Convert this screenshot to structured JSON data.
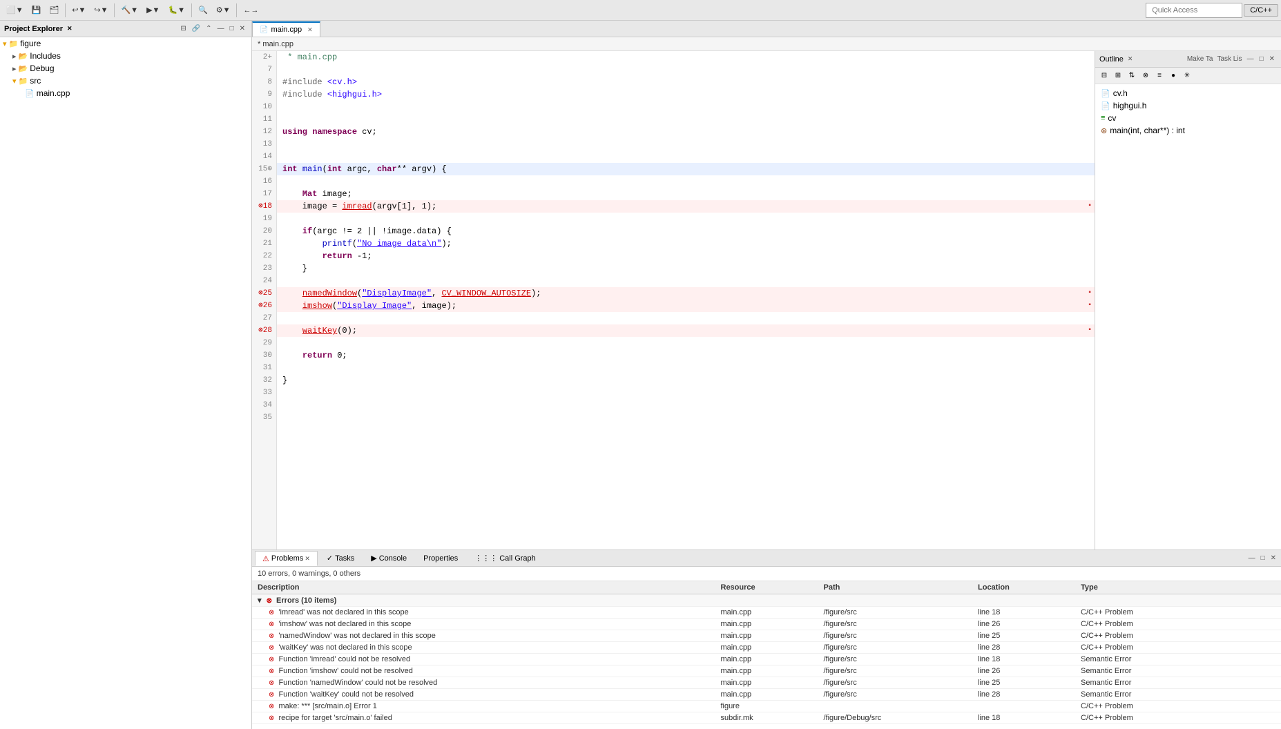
{
  "toolbar": {
    "quick_access_placeholder": "Quick Access",
    "lang_label": "C/C++"
  },
  "project_explorer": {
    "title": "Project Explorer",
    "items": [
      {
        "label": "figure",
        "type": "project",
        "depth": 0,
        "expanded": true
      },
      {
        "label": "Includes",
        "type": "folder",
        "depth": 1,
        "expanded": false
      },
      {
        "label": "Debug",
        "type": "folder",
        "depth": 1,
        "expanded": false
      },
      {
        "label": "src",
        "type": "folder",
        "depth": 1,
        "expanded": true
      },
      {
        "label": "main.cpp",
        "type": "file",
        "depth": 2
      }
    ]
  },
  "editor": {
    "tab_label": "main.cpp",
    "tab_dirty": false,
    "breadcrumb": "* main.cpp",
    "lines": [
      {
        "num": "2+",
        "content": "* main.cpp",
        "type": "comment"
      },
      {
        "num": "7",
        "content": "",
        "type": "normal"
      },
      {
        "num": "8",
        "content": "#include <cv.h>",
        "type": "preproc"
      },
      {
        "num": "9",
        "content": "#include <highgui.h>",
        "type": "preproc"
      },
      {
        "num": "10",
        "content": "",
        "type": "normal"
      },
      {
        "num": "11",
        "content": "",
        "type": "normal"
      },
      {
        "num": "12",
        "content": "using namespace cv;",
        "type": "normal"
      },
      {
        "num": "13",
        "content": "",
        "type": "normal"
      },
      {
        "num": "14",
        "content": "",
        "type": "normal"
      },
      {
        "num": "15♦",
        "content": "int main(int argc, char** argv) {",
        "type": "normal",
        "highlighted": true
      },
      {
        "num": "16",
        "content": "",
        "type": "normal"
      },
      {
        "num": "17",
        "content": "    Mat image;",
        "type": "normal"
      },
      {
        "num": "18",
        "content": "    image = imread(argv[1], 1);",
        "type": "error"
      },
      {
        "num": "19",
        "content": "",
        "type": "normal"
      },
      {
        "num": "20",
        "content": "    if(argc != 2 || !image.data) {",
        "type": "normal"
      },
      {
        "num": "21",
        "content": "        printf(\"No image data\\n\");",
        "type": "normal"
      },
      {
        "num": "22",
        "content": "        return -1;",
        "type": "normal"
      },
      {
        "num": "23",
        "content": "    }",
        "type": "normal"
      },
      {
        "num": "24",
        "content": "",
        "type": "normal"
      },
      {
        "num": "25",
        "content": "    namedWindow(\"DisplayImage\", CV_WINDOW_AUTOSIZE);",
        "type": "error"
      },
      {
        "num": "26",
        "content": "    imshow(\"Display Image\", image);",
        "type": "error"
      },
      {
        "num": "27",
        "content": "",
        "type": "normal"
      },
      {
        "num": "28",
        "content": "    waitKey(0);",
        "type": "error"
      },
      {
        "num": "29",
        "content": "",
        "type": "normal"
      },
      {
        "num": "30",
        "content": "    return 0;",
        "type": "normal"
      },
      {
        "num": "31",
        "content": "",
        "type": "normal"
      },
      {
        "num": "32",
        "content": "}",
        "type": "normal"
      },
      {
        "num": "33",
        "content": "",
        "type": "normal"
      },
      {
        "num": "34",
        "content": "",
        "type": "normal"
      },
      {
        "num": "35",
        "content": "",
        "type": "normal"
      }
    ]
  },
  "bottom_panel": {
    "tabs": [
      {
        "label": "Problems",
        "active": true,
        "icon": "⚠"
      },
      {
        "label": "Tasks",
        "active": false,
        "icon": "✓"
      },
      {
        "label": "Console",
        "active": false,
        "icon": "▶"
      },
      {
        "label": "Properties",
        "active": false,
        "icon": ""
      },
      {
        "label": "Call Graph",
        "active": false,
        "icon": "⋮⋮⋮"
      }
    ],
    "problems_summary": "10 errors, 0 warnings, 0 others",
    "columns": [
      "Description",
      "Resource",
      "Path",
      "Location",
      "Type"
    ],
    "errors_group": "Errors (10 items)",
    "errors": [
      {
        "desc": "'imread' was not declared in this scope",
        "resource": "main.cpp",
        "path": "/figure/src",
        "location": "line 18",
        "type": "C/C++ Problem"
      },
      {
        "desc": "'imshow' was not declared in this scope",
        "resource": "main.cpp",
        "path": "/figure/src",
        "location": "line 26",
        "type": "C/C++ Problem"
      },
      {
        "desc": "'namedWindow' was not declared in this scope",
        "resource": "main.cpp",
        "path": "/figure/src",
        "location": "line 25",
        "type": "C/C++ Problem"
      },
      {
        "desc": "'waitKey' was not declared in this scope",
        "resource": "main.cpp",
        "path": "/figure/src",
        "location": "line 28",
        "type": "C/C++ Problem"
      },
      {
        "desc": "Function 'imread' could not be resolved",
        "resource": "main.cpp",
        "path": "/figure/src",
        "location": "line 18",
        "type": "Semantic Error"
      },
      {
        "desc": "Function 'imshow' could not be resolved",
        "resource": "main.cpp",
        "path": "/figure/src",
        "location": "line 26",
        "type": "Semantic Error"
      },
      {
        "desc": "Function 'namedWindow' could not be resolved",
        "resource": "main.cpp",
        "path": "/figure/src",
        "location": "line 25",
        "type": "Semantic Error"
      },
      {
        "desc": "Function 'waitKey' could not be resolved",
        "resource": "main.cpp",
        "path": "/figure/src",
        "location": "line 28",
        "type": "Semantic Error"
      },
      {
        "desc": "make: *** [src/main.o] Error 1",
        "resource": "figure",
        "path": "",
        "location": "",
        "type": "C/C++ Problem"
      },
      {
        "desc": "recipe for target 'src/main.o' failed",
        "resource": "subdir.mk",
        "path": "/figure/Debug/src",
        "location": "line 18",
        "type": "C/C++ Problem"
      }
    ]
  },
  "outline": {
    "title": "Outline",
    "items": [
      {
        "label": "cv.h",
        "type": "file",
        "depth": 0
      },
      {
        "label": "highgui.h",
        "type": "file",
        "depth": 0
      },
      {
        "label": "cv",
        "type": "namespace",
        "depth": 0
      },
      {
        "label": "main(int, char**) : int",
        "type": "function",
        "depth": 0
      }
    ]
  }
}
